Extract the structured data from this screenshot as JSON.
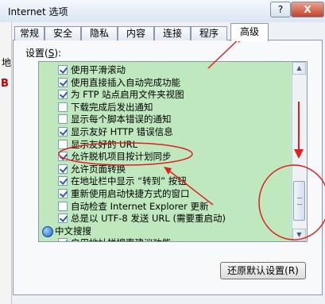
{
  "window": {
    "title": "Internet 选项",
    "help_label": "?",
    "close_label": "X"
  },
  "background_app": {
    "glyph_1": "地",
    "glyph_2": "B"
  },
  "tabs": [
    {
      "label": "常规"
    },
    {
      "label": "安全"
    },
    {
      "label": "隐私"
    },
    {
      "label": "内容"
    },
    {
      "label": "连接"
    },
    {
      "label": "程序"
    },
    {
      "label": "高级",
      "active": true
    }
  ],
  "settings": {
    "label_prefix": "设置(",
    "label_key": "S",
    "label_suffix": "):",
    "items": [
      {
        "label": "使用平滑滚动",
        "checked": true
      },
      {
        "label": "使用直接插入自动完成功能",
        "checked": true
      },
      {
        "label": "为 FTP 站点启用文件夹视图",
        "checked": true
      },
      {
        "label": "下载完成后发出通知",
        "checked": false
      },
      {
        "label": "显示每个脚本错误的通知",
        "checked": false
      },
      {
        "label": "显示友好 HTTP 错误信息",
        "checked": true
      },
      {
        "label": "显示友好的 URL",
        "checked": false
      },
      {
        "label": "允许脱机项目按计划同步",
        "checked": true
      },
      {
        "label": "允许页面转换",
        "checked": true
      },
      {
        "label": "在地址栏中显示 “转到” 按钮",
        "checked": true
      },
      {
        "label": "重新使用启动快捷方式的窗口",
        "checked": true
      },
      {
        "label": "自动检查 Internet Explorer 更新",
        "checked": false
      },
      {
        "label": "总是以 UTF-8 发送 URL (需要重启动)",
        "checked": true
      }
    ],
    "group_label": "中文搜搜",
    "partial_item": "启用地址栏搜索建议功能"
  },
  "buttons": {
    "restore_defaults": "还原默认设置(R)"
  },
  "colors": {
    "list_background": "#bfe8bf",
    "annotation_red": "#e02020"
  }
}
